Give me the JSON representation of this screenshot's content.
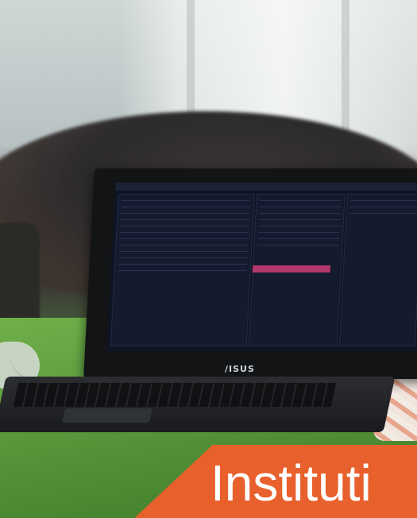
{
  "photo": {
    "laptop_brand": "/ISUS",
    "banner_text": "Instituti",
    "colors": {
      "banner": "#e8602c",
      "table": "#63a643",
      "screen": "#0f1424",
      "highlight_row": "#b0386a"
    }
  }
}
